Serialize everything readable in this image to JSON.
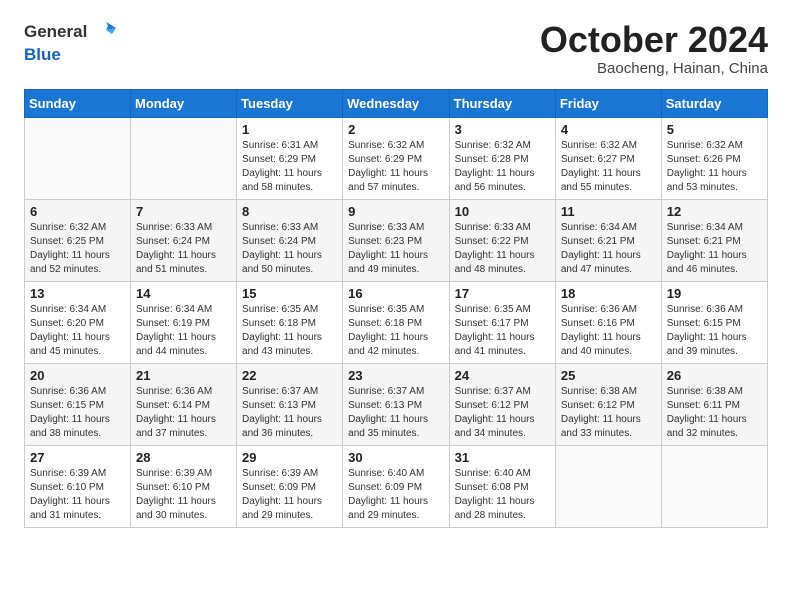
{
  "header": {
    "logo": {
      "line1": "General",
      "line2": "Blue"
    },
    "title": "October 2024",
    "subtitle": "Baocheng, Hainan, China"
  },
  "weekdays": [
    "Sunday",
    "Monday",
    "Tuesday",
    "Wednesday",
    "Thursday",
    "Friday",
    "Saturday"
  ],
  "weeks": [
    [
      {
        "day": "",
        "info": ""
      },
      {
        "day": "",
        "info": ""
      },
      {
        "day": "1",
        "info": "Sunrise: 6:31 AM\nSunset: 6:29 PM\nDaylight: 11 hours and 58 minutes."
      },
      {
        "day": "2",
        "info": "Sunrise: 6:32 AM\nSunset: 6:29 PM\nDaylight: 11 hours and 57 minutes."
      },
      {
        "day": "3",
        "info": "Sunrise: 6:32 AM\nSunset: 6:28 PM\nDaylight: 11 hours and 56 minutes."
      },
      {
        "day": "4",
        "info": "Sunrise: 6:32 AM\nSunset: 6:27 PM\nDaylight: 11 hours and 55 minutes."
      },
      {
        "day": "5",
        "info": "Sunrise: 6:32 AM\nSunset: 6:26 PM\nDaylight: 11 hours and 53 minutes."
      }
    ],
    [
      {
        "day": "6",
        "info": "Sunrise: 6:32 AM\nSunset: 6:25 PM\nDaylight: 11 hours and 52 minutes."
      },
      {
        "day": "7",
        "info": "Sunrise: 6:33 AM\nSunset: 6:24 PM\nDaylight: 11 hours and 51 minutes."
      },
      {
        "day": "8",
        "info": "Sunrise: 6:33 AM\nSunset: 6:24 PM\nDaylight: 11 hours and 50 minutes."
      },
      {
        "day": "9",
        "info": "Sunrise: 6:33 AM\nSunset: 6:23 PM\nDaylight: 11 hours and 49 minutes."
      },
      {
        "day": "10",
        "info": "Sunrise: 6:33 AM\nSunset: 6:22 PM\nDaylight: 11 hours and 48 minutes."
      },
      {
        "day": "11",
        "info": "Sunrise: 6:34 AM\nSunset: 6:21 PM\nDaylight: 11 hours and 47 minutes."
      },
      {
        "day": "12",
        "info": "Sunrise: 6:34 AM\nSunset: 6:21 PM\nDaylight: 11 hours and 46 minutes."
      }
    ],
    [
      {
        "day": "13",
        "info": "Sunrise: 6:34 AM\nSunset: 6:20 PM\nDaylight: 11 hours and 45 minutes."
      },
      {
        "day": "14",
        "info": "Sunrise: 6:34 AM\nSunset: 6:19 PM\nDaylight: 11 hours and 44 minutes."
      },
      {
        "day": "15",
        "info": "Sunrise: 6:35 AM\nSunset: 6:18 PM\nDaylight: 11 hours and 43 minutes."
      },
      {
        "day": "16",
        "info": "Sunrise: 6:35 AM\nSunset: 6:18 PM\nDaylight: 11 hours and 42 minutes."
      },
      {
        "day": "17",
        "info": "Sunrise: 6:35 AM\nSunset: 6:17 PM\nDaylight: 11 hours and 41 minutes."
      },
      {
        "day": "18",
        "info": "Sunrise: 6:36 AM\nSunset: 6:16 PM\nDaylight: 11 hours and 40 minutes."
      },
      {
        "day": "19",
        "info": "Sunrise: 6:36 AM\nSunset: 6:15 PM\nDaylight: 11 hours and 39 minutes."
      }
    ],
    [
      {
        "day": "20",
        "info": "Sunrise: 6:36 AM\nSunset: 6:15 PM\nDaylight: 11 hours and 38 minutes."
      },
      {
        "day": "21",
        "info": "Sunrise: 6:36 AM\nSunset: 6:14 PM\nDaylight: 11 hours and 37 minutes."
      },
      {
        "day": "22",
        "info": "Sunrise: 6:37 AM\nSunset: 6:13 PM\nDaylight: 11 hours and 36 minutes."
      },
      {
        "day": "23",
        "info": "Sunrise: 6:37 AM\nSunset: 6:13 PM\nDaylight: 11 hours and 35 minutes."
      },
      {
        "day": "24",
        "info": "Sunrise: 6:37 AM\nSunset: 6:12 PM\nDaylight: 11 hours and 34 minutes."
      },
      {
        "day": "25",
        "info": "Sunrise: 6:38 AM\nSunset: 6:12 PM\nDaylight: 11 hours and 33 minutes."
      },
      {
        "day": "26",
        "info": "Sunrise: 6:38 AM\nSunset: 6:11 PM\nDaylight: 11 hours and 32 minutes."
      }
    ],
    [
      {
        "day": "27",
        "info": "Sunrise: 6:39 AM\nSunset: 6:10 PM\nDaylight: 11 hours and 31 minutes."
      },
      {
        "day": "28",
        "info": "Sunrise: 6:39 AM\nSunset: 6:10 PM\nDaylight: 11 hours and 30 minutes."
      },
      {
        "day": "29",
        "info": "Sunrise: 6:39 AM\nSunset: 6:09 PM\nDaylight: 11 hours and 29 minutes."
      },
      {
        "day": "30",
        "info": "Sunrise: 6:40 AM\nSunset: 6:09 PM\nDaylight: 11 hours and 29 minutes."
      },
      {
        "day": "31",
        "info": "Sunrise: 6:40 AM\nSunset: 6:08 PM\nDaylight: 11 hours and 28 minutes."
      },
      {
        "day": "",
        "info": ""
      },
      {
        "day": "",
        "info": ""
      }
    ]
  ]
}
